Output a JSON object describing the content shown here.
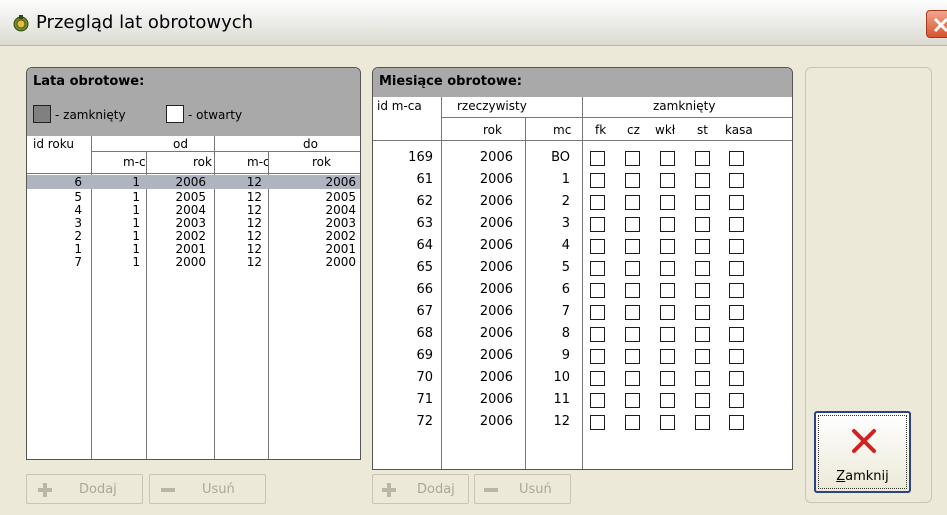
{
  "window": {
    "title": "Przegląd lat obrotowych",
    "close_glyph": "×"
  },
  "left_panel": {
    "title": "Lata obrotowe:",
    "legend_closed": "- zamknięty",
    "legend_open": "- otwarty",
    "headers": {
      "id": "id roku",
      "od": "od",
      "do": "do",
      "od_mc": "m-c",
      "od_rok": "rok",
      "do_mc": "m-c",
      "do_rok": "rok"
    },
    "rows": [
      {
        "id": "6",
        "od_mc": "1",
        "od_rok": "2006",
        "do_mc": "12",
        "do_rok": "2006",
        "selected": true
      },
      {
        "id": "5",
        "od_mc": "1",
        "od_rok": "2005",
        "do_mc": "12",
        "do_rok": "2005"
      },
      {
        "id": "4",
        "od_mc": "1",
        "od_rok": "2004",
        "do_mc": "12",
        "do_rok": "2004"
      },
      {
        "id": "3",
        "od_mc": "1",
        "od_rok": "2003",
        "do_mc": "12",
        "do_rok": "2003"
      },
      {
        "id": "2",
        "od_mc": "1",
        "od_rok": "2002",
        "do_mc": "12",
        "do_rok": "2002"
      },
      {
        "id": "1",
        "od_mc": "1",
        "od_rok": "2001",
        "do_mc": "12",
        "do_rok": "2001"
      },
      {
        "id": "7",
        "od_mc": "1",
        "od_rok": "2000",
        "do_mc": "12",
        "do_rok": "2000"
      }
    ],
    "add_label": "Dodaj",
    "remove_label": "Usuń"
  },
  "right_panel": {
    "title": "Miesiące obrotowe:",
    "headers": {
      "id": "id m-ca",
      "rzeczywisty": "rzeczywisty",
      "rok": "rok",
      "mc": "mc",
      "zamkniety": "zamknięty",
      "fk": "fk",
      "cz": "cz",
      "wkl": "wkł",
      "st": "st",
      "kasa": "kasa"
    },
    "rows": [
      {
        "id": "169",
        "rok": "2006",
        "mc": "BO"
      },
      {
        "id": "61",
        "rok": "2006",
        "mc": "1"
      },
      {
        "id": "62",
        "rok": "2006",
        "mc": "2"
      },
      {
        "id": "63",
        "rok": "2006",
        "mc": "3"
      },
      {
        "id": "64",
        "rok": "2006",
        "mc": "4"
      },
      {
        "id": "65",
        "rok": "2006",
        "mc": "5"
      },
      {
        "id": "66",
        "rok": "2006",
        "mc": "6"
      },
      {
        "id": "67",
        "rok": "2006",
        "mc": "7"
      },
      {
        "id": "68",
        "rok": "2006",
        "mc": "8"
      },
      {
        "id": "69",
        "rok": "2006",
        "mc": "9"
      },
      {
        "id": "70",
        "rok": "2006",
        "mc": "10"
      },
      {
        "id": "71",
        "rok": "2006",
        "mc": "11"
      },
      {
        "id": "72",
        "rok": "2006",
        "mc": "12"
      }
    ],
    "add_label": "Dodaj",
    "remove_label": "Usuń"
  },
  "close_button": {
    "label_accel": "Z",
    "label_rest": "amknij"
  },
  "colors": {
    "panel_header": "#a9a9a9",
    "selected_row": "#aeb5c1",
    "close_icon": "#d32020"
  }
}
